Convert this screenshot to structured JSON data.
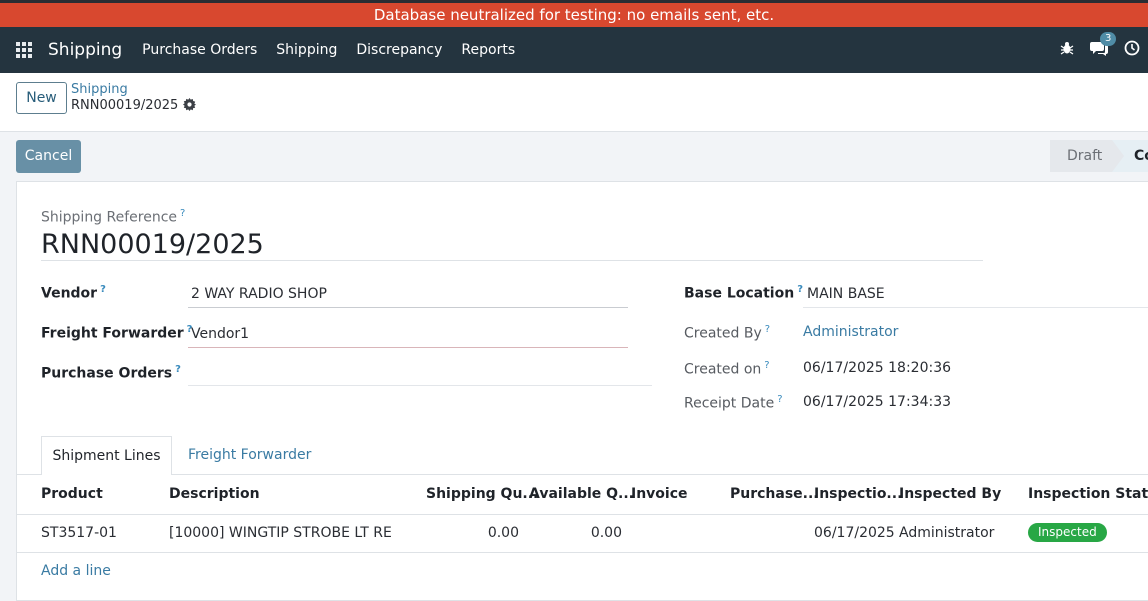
{
  "banner": "Database neutralized for testing: no emails sent, etc.",
  "navbar": {
    "brand": "Shipping",
    "menu": [
      "Purchase Orders",
      "Shipping",
      "Discrepancy",
      "Reports"
    ],
    "messages_count": "3"
  },
  "control_panel": {
    "new_label": "New",
    "breadcrumb_parent": "Shipping",
    "breadcrumb_current": "RNN00019/2025"
  },
  "actions": {
    "cancel_label": "Cancel"
  },
  "statusbar": {
    "stages": [
      "Draft",
      "Co"
    ]
  },
  "form": {
    "ref_label": "Shipping Reference",
    "ref_value": "RNN00019/2025",
    "vendor_label": "Vendor",
    "vendor_value": "2 WAY RADIO SHOP",
    "freight_label": "Freight Forwarder",
    "freight_value": "Vendor1",
    "po_label": "Purchase Orders",
    "po_value": "",
    "base_label": "Base Location",
    "base_value": "MAIN BASE",
    "created_by_label": "Created By",
    "created_by_value": "Administrator",
    "created_on_label": "Created on",
    "created_on_value": "06/17/2025 18:20:36",
    "receipt_label": "Receipt Date",
    "receipt_value": "06/17/2025 17:34:33"
  },
  "tabs": [
    "Shipment Lines",
    "Freight Forwarder"
  ],
  "table": {
    "columns": [
      "Product",
      "Description",
      "Shipping Qu...",
      "Available Q...",
      "Invoice",
      "Purchase...",
      "Inspectio...",
      "Inspected By",
      "Inspection Status"
    ],
    "rows": [
      {
        "product": "ST3517-01",
        "description": "[10000] WINGTIP STROBE LT RE",
        "shipping_qty": "0.00",
        "available_qty": "0.00",
        "invoice": "",
        "purchase": "",
        "inspection_date": "06/17/2025",
        "inspected_by": "Administrator",
        "inspection_status": "Inspected"
      }
    ],
    "add_line": "Add a line"
  },
  "colors": {
    "banner": "#d8482f",
    "navbar": "#24343f",
    "accent": "#3a7ba3",
    "inspected": "#28a745"
  },
  "icons": [
    "apps-grid-icon",
    "bug-icon",
    "chat-icon",
    "clock-icon",
    "gear-icon",
    "help-icon"
  ]
}
